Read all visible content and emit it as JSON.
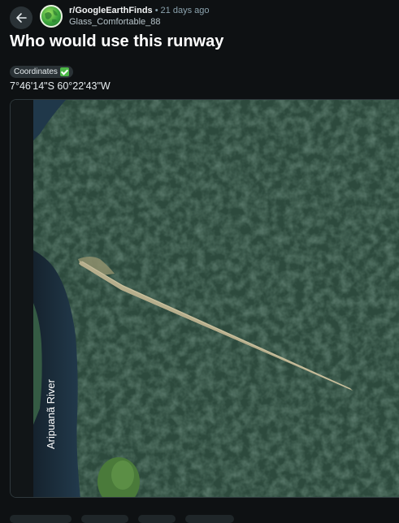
{
  "post": {
    "subreddit": "r/GoogleEarthFinds",
    "separator": "•",
    "time_ago": "21 days ago",
    "username": "Glass_Comfortable_88",
    "title": "Who would use this runway",
    "flair": "Coordinates",
    "coordinates": "7°46'14\"S 60°22'43\"W"
  },
  "image": {
    "river_label": "Aripuanã River"
  },
  "colors": {
    "background": "#0e1113",
    "forest": "#2d4a3d",
    "river": "#1b2d3e",
    "runway": "#b6ae8c",
    "flair_check": "#4cb847"
  },
  "icons": {
    "back": "arrow-left-icon",
    "avatar": "subreddit-globe-avatar",
    "flair_check": "check-mark-icon"
  }
}
